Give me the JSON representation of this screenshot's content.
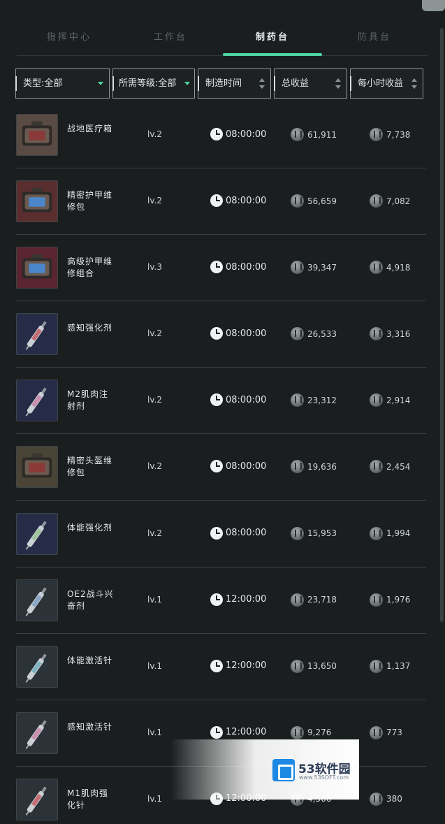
{
  "tabs": [
    {
      "label": "指挥中心",
      "active": false
    },
    {
      "label": "工作台",
      "active": false
    },
    {
      "label": "制药台",
      "active": true
    },
    {
      "label": "防具台",
      "active": false
    }
  ],
  "filters": {
    "type": "类型:全部",
    "level": "所需等级:全部",
    "time": "制造时间",
    "total": "总收益",
    "hourly": "每小时收益"
  },
  "items": [
    {
      "name": "战地医疗箱",
      "level": "lv.2",
      "time": "08:00:00",
      "total": "61,911",
      "hourly": "7,738",
      "icon": "medical-kit-icon",
      "color": "#5a4a44"
    },
    {
      "name": "精密护甲维修包",
      "level": "lv.2",
      "time": "08:00:00",
      "total": "56,659",
      "hourly": "7,082",
      "icon": "armor-repair-kit-icon",
      "color": "#5a2e2e"
    },
    {
      "name": "高级护甲维修组合",
      "level": "lv.3",
      "time": "08:00:00",
      "total": "39,347",
      "hourly": "4,918",
      "icon": "armor-repair-combo-icon",
      "color": "#5a2430"
    },
    {
      "name": "感知强化剂",
      "level": "lv.2",
      "time": "08:00:00",
      "total": "26,533",
      "hourly": "3,316",
      "icon": "syringe-icon",
      "color": "#262c48"
    },
    {
      "name": "M2肌肉注射剂",
      "level": "lv.2",
      "time": "08:00:00",
      "total": "23,312",
      "hourly": "2,914",
      "icon": "syringe-icon",
      "color": "#262c48"
    },
    {
      "name": "精密头盔维修包",
      "level": "lv.2",
      "time": "08:00:00",
      "total": "19,636",
      "hourly": "2,454",
      "icon": "helmet-repair-kit-icon",
      "color": "#4a4436"
    },
    {
      "name": "体能强化剂",
      "level": "lv.2",
      "time": "08:00:00",
      "total": "15,953",
      "hourly": "1,994",
      "icon": "syringe-icon",
      "color": "#262c48"
    },
    {
      "name": "OE2战斗兴奋剂",
      "level": "lv.1",
      "time": "12:00:00",
      "total": "23,718",
      "hourly": "1,976",
      "icon": "syringe-icon",
      "color": "#2c3338"
    },
    {
      "name": "体能激活针",
      "level": "lv.1",
      "time": "12:00:00",
      "total": "13,650",
      "hourly": "1,137",
      "icon": "syringe-icon",
      "color": "#2c3338"
    },
    {
      "name": "感知激活针",
      "level": "lv.1",
      "time": "12:00:00",
      "total": "9,276",
      "hourly": "773",
      "icon": "syringe-icon",
      "color": "#2c3338"
    },
    {
      "name": "M1肌肉强化针",
      "level": "lv.1",
      "time": "12:00:00",
      "total": "4,566",
      "hourly": "380",
      "icon": "syringe-icon",
      "color": "#2c3338"
    }
  ],
  "watermark": {
    "title": "53软件园",
    "url": "www.53SOFT.com"
  }
}
